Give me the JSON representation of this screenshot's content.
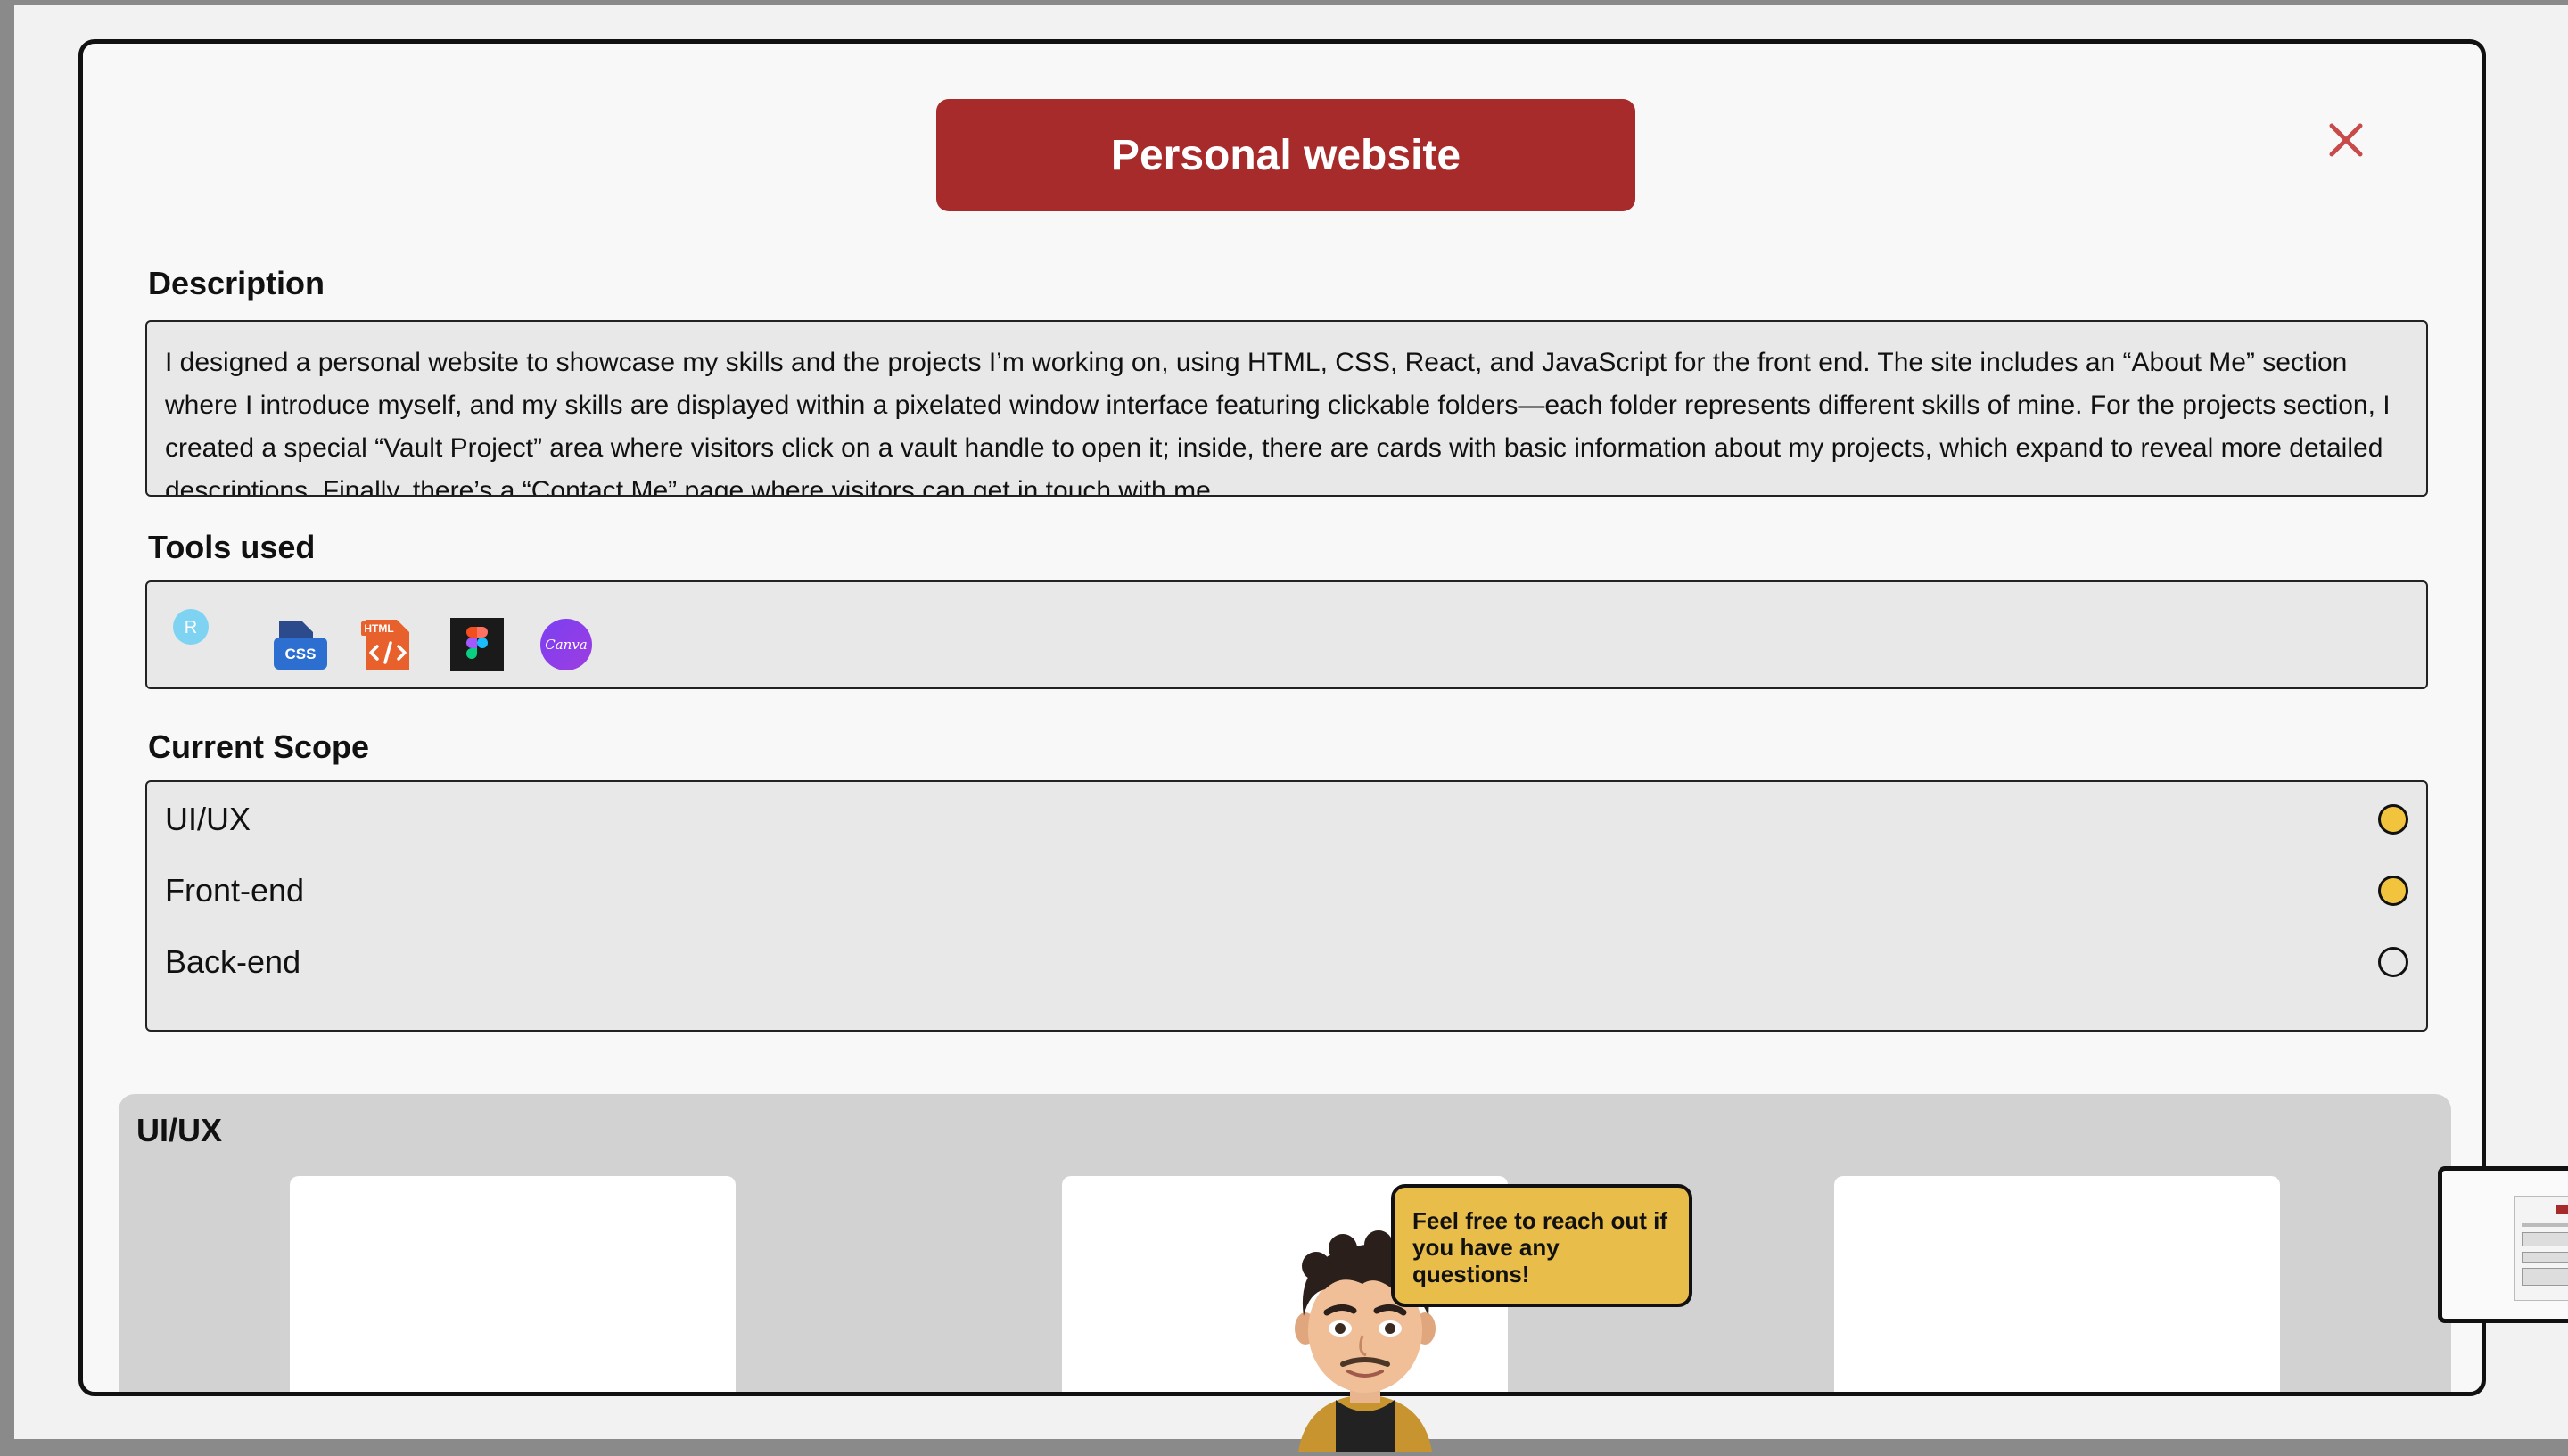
{
  "modal": {
    "title": "Personal website",
    "close_symbol": "×",
    "description": {
      "label": "Description",
      "text": "I designed a personal website to showcase my skills and the projects I’m working on, using HTML, CSS, React, and JavaScript for the front end. The site includes an “About Me” section where I introduce myself, and my skills are displayed within a pixelated window interface featuring clickable folders—each folder represents different skills of mine. For the projects section, I created a special “Vault Project” area where visitors click on a vault handle to open it; inside, there are cards with basic information about my projects, which expand to reveal more detailed descriptions. Finally, there’s a “Contact Me” page where visitors can get in touch with me."
    },
    "tools": {
      "label": "Tools used",
      "items": [
        {
          "icon": "react-icon",
          "text": "R"
        },
        {
          "icon": "css-icon",
          "text": "CSS"
        },
        {
          "icon": "html-icon",
          "text": "HTML"
        },
        {
          "icon": "figma-icon"
        },
        {
          "icon": "canva-icon",
          "text": "Canva"
        }
      ]
    },
    "scope": {
      "label": "Current Scope",
      "items": [
        {
          "label": "UI/UX",
          "active": true
        },
        {
          "label": "Front-end",
          "active": true
        },
        {
          "label": "Back-end",
          "active": false
        }
      ]
    },
    "uiux": {
      "title": "UI/UX"
    }
  },
  "chat": {
    "bubble_text": "Feel free to reach out if you have any questions!"
  },
  "colors": {
    "accent_red": "#a72b2b",
    "close_red": "#c84a4a",
    "scope_active": "#f2c43d",
    "bubble_yellow": "#e8bd4a"
  }
}
